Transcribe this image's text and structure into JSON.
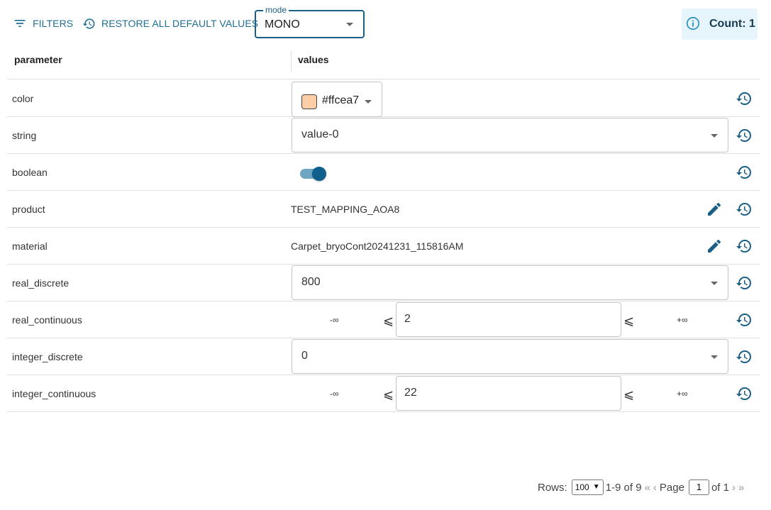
{
  "toolbar": {
    "filters_label": "FILTERS",
    "restore_label": "RESTORE ALL DEFAULT VALUES",
    "mode_legend": "mode",
    "mode_value": "MONO",
    "count_label": "Count: 1",
    "accent_color": "#1f6f93"
  },
  "table": {
    "columns": [
      "parameter",
      "values"
    ],
    "rows": [
      {
        "name": "color",
        "value": "#ffcea7"
      },
      {
        "name": "string",
        "value": "value-0"
      },
      {
        "name": "boolean",
        "value": true
      },
      {
        "name": "product",
        "value": "TEST_MAPPING_AOA8"
      },
      {
        "name": "material",
        "value": "Carpet_bryoCont20241231_115816AM"
      },
      {
        "name": "real_discrete",
        "value": "800"
      },
      {
        "name": "real_continuous",
        "min": "-∞",
        "leq": "⩽",
        "value": "2",
        "max": "+∞"
      },
      {
        "name": "integer_discrete",
        "value": "0"
      },
      {
        "name": "integer_continuous",
        "min": "-∞",
        "leq": "⩽",
        "value": "22",
        "max": "+∞"
      }
    ]
  },
  "pagination": {
    "rows_label": "Rows:",
    "rows_per_page": "100",
    "range": "1-9 of 9",
    "first_icon": "«",
    "prev_icon": "‹",
    "page_label": "Page",
    "current_page": "1",
    "of_pages": "of 1",
    "next_icon": "›",
    "last_icon": "»"
  },
  "icons": {
    "filter": "filter-list-icon",
    "restore": "restore-icon",
    "info": "info-icon",
    "reset": "history-icon",
    "edit": "pencil-icon"
  }
}
